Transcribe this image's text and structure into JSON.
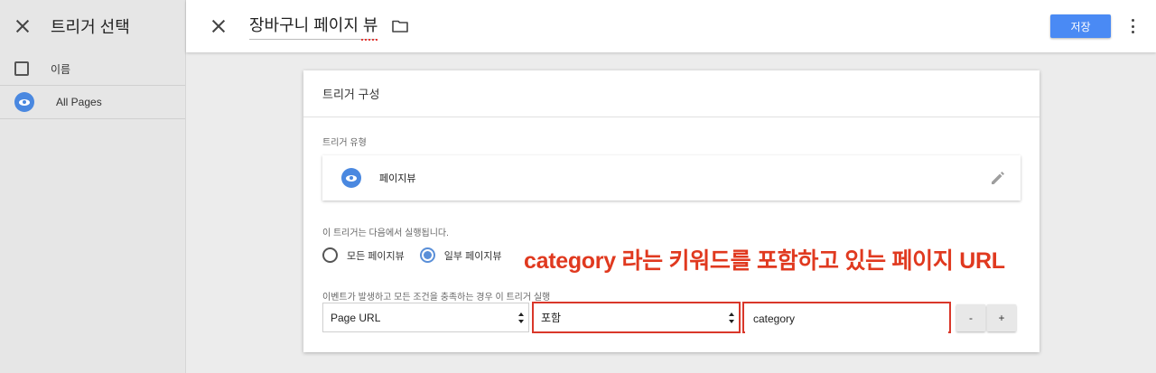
{
  "left_panel": {
    "title": "트리거 선택",
    "rows": [
      {
        "label": "이름"
      },
      {
        "label": "All Pages"
      }
    ]
  },
  "topbar": {
    "title": "장바구니 페이지 뷰",
    "save_label": "저장"
  },
  "card": {
    "header": "트리거 구성",
    "type_section_label": "트리거 유형",
    "type_value": "페이지뷰",
    "fires_on_label": "이 트리거는 다음에서 실행됩니다.",
    "radio_all": "모든 페이지뷰",
    "radio_some": "일부 페이지뷰",
    "selected_radio": "일부 페이지뷰",
    "condition_label": "이벤트가 발생하고 모든 조건을 충족하는 경우 이 트리거 실행",
    "condition": {
      "variable": "Page URL",
      "operator": "포함",
      "value": "category"
    },
    "minus_label": "-",
    "plus_label": "+"
  },
  "annotation": "category 라는 키워드를 포함하고 있는 페이지 URL",
  "colors": {
    "accent_blue": "#4a8af4",
    "annotation_red": "#e0391f",
    "highlight_box_red": "#d9372a"
  }
}
